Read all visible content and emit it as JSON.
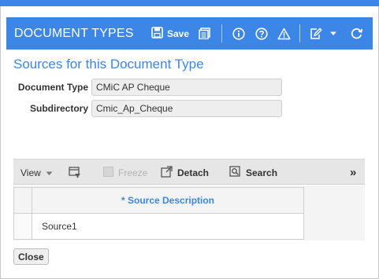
{
  "header": {
    "title": "DOCUMENT TYPES",
    "save_label": "Save",
    "icons": [
      "save-icon",
      "report-icon",
      "info-icon",
      "help-icon",
      "warning-icon",
      "edit-icon",
      "dropdown-icon",
      "refresh-icon"
    ]
  },
  "section": {
    "title": "Sources for this Document Type"
  },
  "form": {
    "document_type": {
      "label": "Document Type",
      "value": "CMiC AP Cheque"
    },
    "subdirectory": {
      "label": "Subdirectory",
      "value": "Cmic_Ap_Cheque"
    }
  },
  "toolbar": {
    "view_label": "View",
    "freeze_label": "Freeze",
    "detach_label": "Detach",
    "search_label": "Search",
    "more_label": "»"
  },
  "grid": {
    "column_header": "* Source Description",
    "rows": [
      {
        "source_description": "Source1"
      }
    ]
  },
  "footer": {
    "close_label": "Close"
  },
  "colors": {
    "accent": "#3b86e6",
    "toolbar_bg": "#e6e6e6"
  }
}
